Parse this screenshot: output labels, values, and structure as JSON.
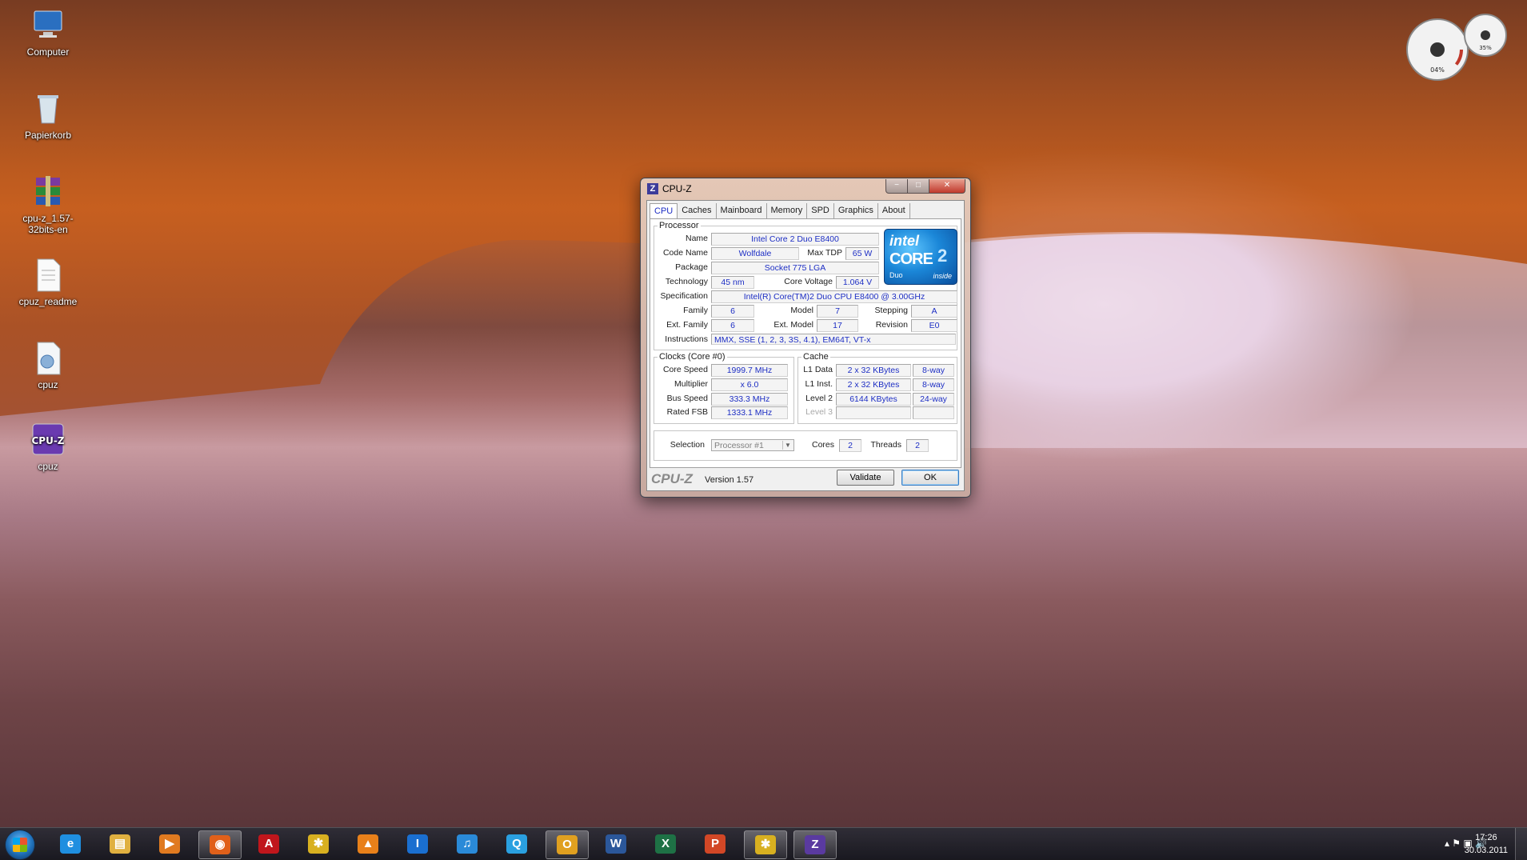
{
  "desktop_icons": [
    {
      "label": "Computer",
      "icon": "computer-icon"
    },
    {
      "label": "Papierkorb",
      "icon": "recycle-bin-icon"
    },
    {
      "label": "cpu-z_1.57-32bits-en",
      "icon": "winrar-archive-icon"
    },
    {
      "label": "cpuz_readme",
      "icon": "text-document-icon"
    },
    {
      "label": "cpuz",
      "icon": "settings-file-icon"
    },
    {
      "label": "cpuz",
      "icon": "cpuz-app-icon"
    }
  ],
  "window": {
    "title": "CPU-Z",
    "controls": {
      "minimize": "−",
      "maximize": "□",
      "close": "✕"
    },
    "tabs": [
      "CPU",
      "Caches",
      "Mainboard",
      "Memory",
      "SPD",
      "Graphics",
      "About"
    ],
    "active_tab": "CPU",
    "processor": {
      "legend": "Processor",
      "name_label": "Name",
      "name": "Intel Core 2 Duo E8400",
      "codename_label": "Code Name",
      "codename": "Wolfdale",
      "maxtdp_label": "Max TDP",
      "maxtdp": "65 W",
      "package_label": "Package",
      "package": "Socket 775 LGA",
      "technology_label": "Technology",
      "technology": "45 nm",
      "voltage_label": "Core Voltage",
      "voltage": "1.064 V",
      "spec_label": "Specification",
      "spec": "Intel(R) Core(TM)2 Duo CPU     E8400  @ 3.00GHz",
      "family_label": "Family",
      "family": "6",
      "model_label": "Model",
      "model": "7",
      "stepping_label": "Stepping",
      "stepping": "A",
      "extfamily_label": "Ext. Family",
      "extfamily": "6",
      "extmodel_label": "Ext. Model",
      "extmodel": "17",
      "revision_label": "Revision",
      "revision": "E0",
      "instructions_label": "Instructions",
      "instructions": "MMX, SSE (1, 2, 3, 3S, 4.1), EM64T, VT-x"
    },
    "intel_logo": {
      "brand": "intel",
      "product": "CORE",
      "number": "2",
      "line": "Duo",
      "suffix": "inside"
    },
    "clocks": {
      "legend": "Clocks (Core #0)",
      "corespeed_label": "Core Speed",
      "corespeed": "1999.7 MHz",
      "multiplier_label": "Multiplier",
      "multiplier": "x 6.0",
      "busspeed_label": "Bus Speed",
      "busspeed": "333.3 MHz",
      "ratedfsb_label": "Rated FSB",
      "ratedfsb": "1333.1 MHz"
    },
    "cache": {
      "legend": "Cache",
      "l1data_label": "L1 Data",
      "l1data": "2 x 32 KBytes",
      "l1data_way": "8-way",
      "l1inst_label": "L1 Inst.",
      "l1inst": "2 x 32 KBytes",
      "l1inst_way": "8-way",
      "level2_label": "Level 2",
      "level2": "6144 KBytes",
      "level2_way": "24-way",
      "level3_label": "Level 3",
      "level3": "",
      "level3_way": ""
    },
    "selection": {
      "label": "Selection",
      "value": "Processor #1",
      "cores_label": "Cores",
      "cores": "2",
      "threads_label": "Threads",
      "threads": "2"
    },
    "footer": {
      "logo": "CPU-Z",
      "version": "Version 1.57",
      "validate": "Validate",
      "ok": "OK"
    }
  },
  "taskbar": {
    "apps": [
      {
        "icon": "internet-explorer-icon",
        "glyph": "e",
        "color": "#1f8fe0",
        "active": false
      },
      {
        "icon": "windows-explorer-icon",
        "glyph": "▤",
        "color": "#e0b040",
        "active": false
      },
      {
        "icon": "media-player-icon",
        "glyph": "▶",
        "color": "#e07a20",
        "active": false
      },
      {
        "icon": "firefox-icon",
        "glyph": "◉",
        "color": "#e0601a",
        "active": true
      },
      {
        "icon": "acrobat-reader-icon",
        "glyph": "A",
        "color": "#c0161c",
        "active": false
      },
      {
        "icon": "msn-messenger-icon",
        "glyph": "✱",
        "color": "#d8b020",
        "active": false
      },
      {
        "icon": "vlc-icon",
        "glyph": "▲",
        "color": "#e8801a",
        "active": false
      },
      {
        "icon": "text-editor-icon",
        "glyph": "I",
        "color": "#1a6fd0",
        "active": false
      },
      {
        "icon": "itunes-icon",
        "glyph": "♫",
        "color": "#2a8ad8",
        "active": false
      },
      {
        "icon": "search-app-icon",
        "glyph": "Q",
        "color": "#2aa0e0",
        "active": false
      },
      {
        "icon": "outlook-icon",
        "glyph": "O",
        "color": "#e0a020",
        "active": true
      },
      {
        "icon": "word-icon",
        "glyph": "W",
        "color": "#2b579a",
        "active": false
      },
      {
        "icon": "excel-icon",
        "glyph": "X",
        "color": "#1e7145",
        "active": false
      },
      {
        "icon": "powerpoint-icon",
        "glyph": "P",
        "color": "#d24726",
        "active": false
      },
      {
        "icon": "msn-messenger-icon",
        "glyph": "✱",
        "color": "#d8b020",
        "active": true
      },
      {
        "icon": "cpuz-app-icon",
        "glyph": "Z",
        "color": "#5a3aa0",
        "active": true
      }
    ],
    "tray_icons": [
      "show-hidden-icons-arrow",
      "action-center-flag-icon",
      "network-icon",
      "volume-icon"
    ],
    "tray_glyphs": "▴  ⚑  ▣  🔊",
    "time": "17:26",
    "date": "30.03.2011"
  },
  "gadget": {
    "cpu_percent": "04%",
    "memory_percent": "35%"
  }
}
